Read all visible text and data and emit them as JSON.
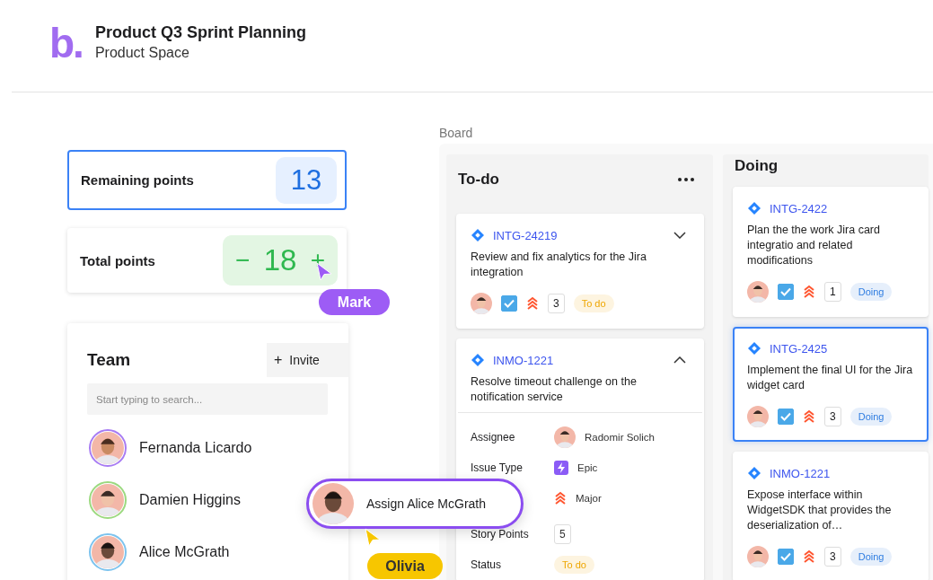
{
  "header": {
    "logo": "b.",
    "title": "Product Q3 Sprint Planning",
    "subtitle": "Product Space"
  },
  "remaining": {
    "label": "Remaining points",
    "value": "13"
  },
  "total": {
    "label": "Total points",
    "decrement": "−",
    "value": "18",
    "increment": "+"
  },
  "team": {
    "title": "Team",
    "invite": {
      "icon": "+",
      "label": "Invite"
    },
    "search": {
      "placeholder": "Start typing to search..."
    },
    "members": [
      {
        "name": "Fernanda Licardo",
        "color": "#a77bf3"
      },
      {
        "name": "Damien Higgins",
        "color": "#9bd97f"
      },
      {
        "name": "Alice McGrath",
        "color": "#7cc3ee"
      }
    ]
  },
  "board": {
    "label": "Board",
    "columns": [
      {
        "title": "To-do",
        "menu": true,
        "cards": [
          {
            "id": "INTG-24219",
            "title": "Review and fix analytics for the Jira integration",
            "expanded": false,
            "selected": false,
            "checked": true,
            "points": "3",
            "status": {
              "label": "To do",
              "color": "#eea600"
            }
          },
          {
            "id": "INMO-1221",
            "title": "Resolve timeout challenge on the notification service",
            "expanded": true,
            "selected": false,
            "details": [
              {
                "kind": "person",
                "label": "Assignee",
                "value": "Radomir Solich"
              },
              {
                "kind": "type",
                "label": "Issue Type",
                "value": "Epic"
              },
              {
                "kind": "priority",
                "value": "Major"
              },
              {
                "kind": "number",
                "label": "Story Points",
                "value": "5"
              },
              {
                "kind": "status",
                "label": "Status",
                "value": "To do",
                "color": "#eea600"
              }
            ]
          }
        ]
      },
      {
        "title": "Doing",
        "menu": false,
        "cards": [
          {
            "id": "INTG-2422",
            "title": "Plan the the work Jira card integratio and related modifications",
            "selected": false,
            "checked": true,
            "points": "1",
            "status": {
              "label": "Doing",
              "color": "#2f7de1"
            }
          },
          {
            "id": "INTG-2425",
            "title": "Implement the final UI for the Jira widget card",
            "selected": true,
            "checked": true,
            "points": "3",
            "status": {
              "label": "Doing",
              "color": "#2f7de1"
            }
          },
          {
            "id": "INMO-1221",
            "title": "Expose interface within WidgetSDK that provides the deserialization of…",
            "selected": false,
            "checked": true,
            "points": "3",
            "status": {
              "label": "Doing",
              "color": "#2f7de1"
            }
          }
        ]
      }
    ]
  },
  "popup": {
    "label": "Assign Alice McGrath"
  },
  "cursors": [
    {
      "name": "Mark",
      "color": "#9d5cf5"
    },
    {
      "name": "Olivia",
      "color": "#f7c600"
    }
  ]
}
